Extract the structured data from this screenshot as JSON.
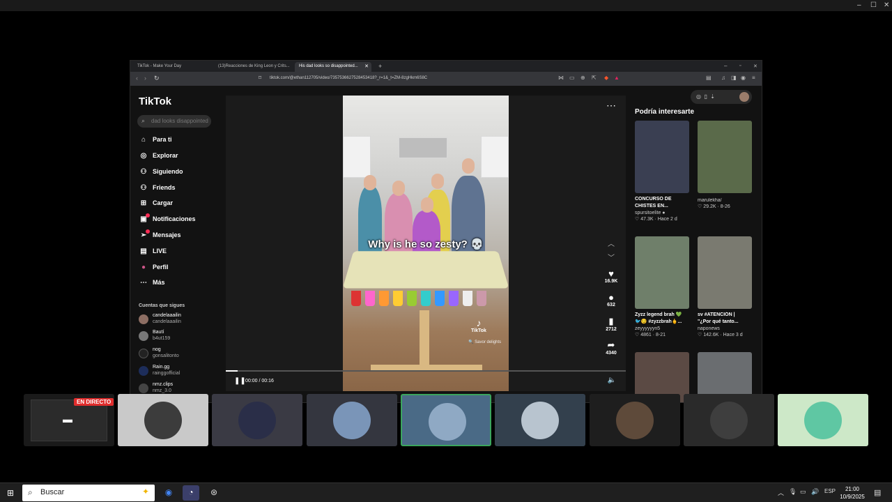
{
  "window_controls": [
    "–",
    "☐",
    "✕"
  ],
  "browser": {
    "tabs": [
      {
        "label": "TikTok - Make Your Day"
      },
      {
        "label": "(13)Reacciones de King Leon y Crits..."
      },
      {
        "label": "His dad looks so disappointed..."
      }
    ],
    "url": "tiktok.com/@ethan112705/video/7357536627528453418?_r=1&_t=ZM-8zgHkm6S8C"
  },
  "tiktok": {
    "logo": "TikTok",
    "search_placeholder": "dad looks disappointed",
    "nav": [
      {
        "label": "Para ti",
        "icon": "home-icon",
        "glyph": "⌂"
      },
      {
        "label": "Explorar",
        "icon": "compass-icon",
        "glyph": "◎"
      },
      {
        "label": "Siguiendo",
        "icon": "following-icon",
        "glyph": "⚇"
      },
      {
        "label": "Friends",
        "icon": "friends-icon",
        "glyph": "⚇"
      },
      {
        "label": "Cargar",
        "icon": "upload-icon",
        "glyph": "⊞"
      },
      {
        "label": "Notificaciones",
        "icon": "inbox-icon",
        "glyph": "▣"
      },
      {
        "label": "Mensajes",
        "icon": "messages-icon",
        "glyph": "➢"
      },
      {
        "label": "LIVE",
        "icon": "live-icon",
        "glyph": "▤"
      },
      {
        "label": "Perfil",
        "icon": "profile-avatar-icon",
        "glyph": "●"
      },
      {
        "label": "Más",
        "icon": "more-icon",
        "glyph": "⋯"
      }
    ],
    "following_title": "Cuentas que sigues",
    "following": [
      {
        "name": "candelaaailin",
        "handle": "candelaaailin"
      },
      {
        "name": "Bautí",
        "handle": "b4ut159"
      },
      {
        "name": "nog",
        "handle": "gonsalitonto"
      },
      {
        "name": "Rain.gg",
        "handle": "rainggofficial"
      },
      {
        "name": "nmz.clips",
        "handle": "nmz_3.0"
      }
    ],
    "video": {
      "caption": "Why is he so zesty? 💀",
      "watermark": "TikTok",
      "watermark_handle": "🔍 Savor delights",
      "time": "00:00 / 00:16",
      "progress": 0.03,
      "author": "ethan112705",
      "stats": [
        {
          "icon": "heart-icon",
          "glyph": "♥",
          "count": "16.9K"
        },
        {
          "icon": "comment-icon",
          "glyph": "●",
          "count": "632"
        },
        {
          "icon": "bookmark-icon",
          "glyph": "▮",
          "count": "2712"
        },
        {
          "icon": "share-icon",
          "glyph": "➦",
          "count": "4340"
        }
      ]
    },
    "recs_title": "Podría interesarte",
    "recs": [
      {
        "title": "CONCURSO DE",
        "title2": "CHISTES EN...",
        "author": "spursitoelite ●",
        "meta": "♡ 47.3K · Hace 2 d",
        "color": "#3a3f52"
      },
      {
        "title": "",
        "title2": "",
        "author": "marulekha/",
        "meta": "♡ 29.2K · 8-26",
        "color": "#5a6a4a"
      },
      {
        "title": "Zyzz legend brah 💚",
        "title2": "🐦😏 #zyzzbrah🖕...",
        "author": "zeyyyyyyn5",
        "meta": "♡ 4861 · 8-21",
        "color": "#6f7f6a"
      },
      {
        "title": "sv #ATENCIÓN |",
        "title2": "\"¿Por qué tanto...",
        "author": "naponews",
        "meta": "♡ 142.6K · Hace 3 d",
        "color": "#7a7a70"
      },
      {
        "title": "",
        "title2": "",
        "author": "",
        "meta": "",
        "color": "#5b4a44"
      },
      {
        "title": "",
        "title2": "",
        "author": "",
        "meta": "",
        "color": "#6a6d70"
      }
    ]
  },
  "call": {
    "live_label": "EN DIRECTO"
  },
  "taskbar": {
    "search": "Buscar",
    "lang": "ESP",
    "time": "21:00",
    "date": "10/9/2025"
  }
}
